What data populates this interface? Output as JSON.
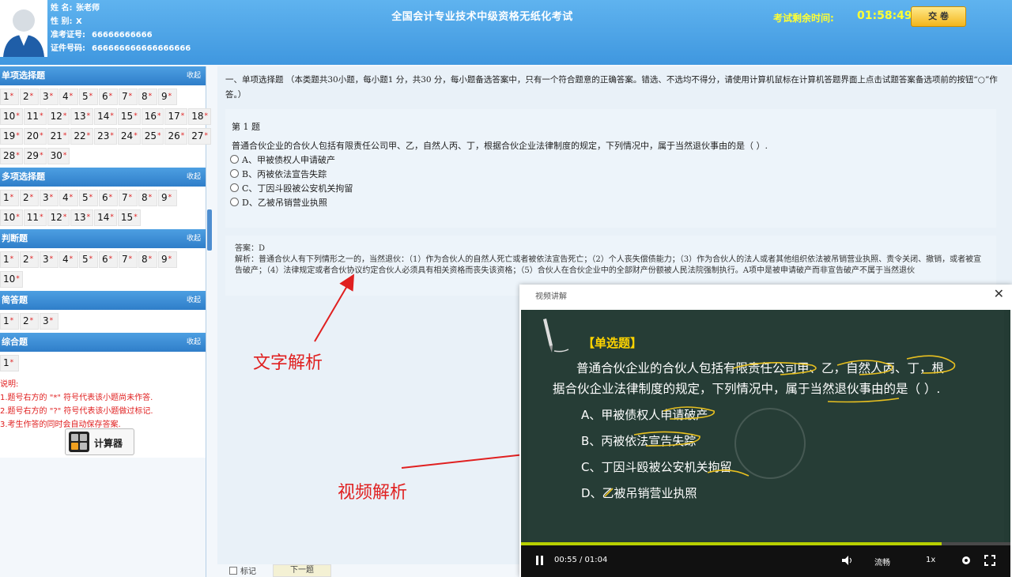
{
  "candidate": {
    "name_label": "姓 名:",
    "name": "张老师",
    "gender_label": "性 别:",
    "gender": "X",
    "ticket_label": "准考证号:",
    "ticket": "66666666666",
    "id_label": "证件号码:",
    "id": "666666666666666666"
  },
  "exam_title": "全国会计专业技术中级资格无纸化考试",
  "timer": {
    "label": "考试剩余时间:",
    "value": "01:58:49"
  },
  "submit_label": "交 卷",
  "sidebar": {
    "collapse_label": "收起",
    "sections": [
      {
        "title": "单项选择题",
        "rows": [
          [
            "1",
            "2",
            "3",
            "4",
            "5",
            "6",
            "7",
            "8",
            "9"
          ],
          [
            "10",
            "11",
            "12",
            "13",
            "14",
            "15",
            "16",
            "17",
            "18"
          ],
          [
            "19",
            "20",
            "21",
            "22",
            "23",
            "24",
            "25",
            "26",
            "27"
          ],
          [
            "28",
            "29",
            "30"
          ]
        ]
      },
      {
        "title": "多项选择题",
        "rows": [
          [
            "1",
            "2",
            "3",
            "4",
            "5",
            "6",
            "7",
            "8",
            "9"
          ],
          [
            "10",
            "11",
            "12",
            "13",
            "14",
            "15"
          ]
        ]
      },
      {
        "title": "判断题",
        "rows": [
          [
            "1",
            "2",
            "3",
            "4",
            "5",
            "6",
            "7",
            "8",
            "9"
          ],
          [
            "10"
          ]
        ]
      },
      {
        "title": "简答题",
        "rows": [
          [
            "1",
            "2",
            "3"
          ]
        ]
      },
      {
        "title": "综合题",
        "rows": [
          [
            "1"
          ]
        ]
      }
    ],
    "notes": [
      "说明:",
      "1.题号右方的 \"*\" 符号代表该小题尚未作答.",
      "2.题号右方的 \"?\" 符号代表该小题做过标记.",
      "3.考生作答的同时会自动保存答案."
    ],
    "calc_label": "计算器"
  },
  "question": {
    "instruction": "一、单项选择题 （本类题共30小题，每小题1 分，共30 分，每小题备选答案中，只有一个符合题意的正确答案。错选、不选均不得分，请使用计算机鼠标在计算机答题界面上点击试题答案备选项前的按钮“○”作答。）",
    "number": "第 1 题",
    "stem": "普通合伙企业的合伙人包括有限责任公司甲、乙，自然人丙、丁，根据合伙企业法律制度的规定，下列情况中，属于当然退伙事由的是（ ）.",
    "options": [
      "A、甲被债权人申请破产",
      "B、丙被依法宣告失踪",
      "C、丁因斗殴被公安机关拘留",
      "D、乙被吊销营业执照"
    ],
    "answer": "答案：D",
    "analysis": "解析：普通合伙人有下列情形之一的，当然退伙：（1）作为合伙人的自然人死亡或者被依法宣告死亡；（2）个人丧失偿债能力；（3）作为合伙人的法人或者其他组织依法被吊销营业执照、责令关闭、撤销，或者被宣告破产；（4）法律规定或者合伙协议约定合伙人必须具有相关资格而丧失该资格；（5）合伙人在合伙企业中的全部财产份额被人民法院强制执行。A项中是被申请破产而非宣告破产不属于当然退伙"
  },
  "bottom": {
    "mark_label": "标记",
    "next_label": "下一题"
  },
  "annotations": {
    "text_analysis": "文字解析",
    "video_analysis": "视频解析"
  },
  "video": {
    "title": "视频讲解",
    "tag": "【单选题】",
    "stem_line1": "普通合伙企业的合伙人包括有限责任公司甲、乙，自然人丙、丁，根",
    "stem_line2": "据合伙企业法律制度的规定，下列情况中，属于当然退伙事由的是（ ）.",
    "options": [
      "A、甲被债权人申请破产",
      "B、丙被依法宣告失踪",
      "C、丁因斗殴被公安机关拘留",
      "D、乙被吊销营业执照"
    ],
    "time": "00:55 / 01:04",
    "progress": 0.86,
    "quality_label": "流畅",
    "speed_label": "1x"
  },
  "colors": {
    "header": "#3f97df",
    "accent_red": "#e02020",
    "timer": "#ffff33",
    "progress": "#b8d000"
  }
}
